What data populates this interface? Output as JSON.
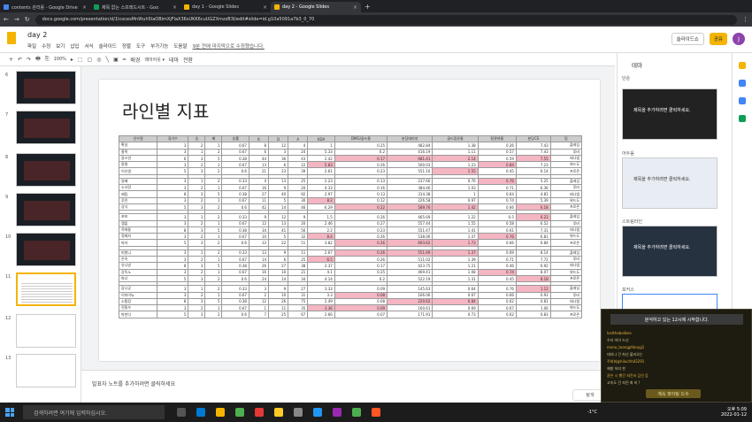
{
  "browser": {
    "tabs": [
      {
        "label": "contents 관리용 - Google Drive",
        "color": "#4285f4"
      },
      {
        "label": "제목 없는 스프레드시트 - Goo",
        "color": "#0f9d58"
      },
      {
        "label": "day 1 - Google Slides",
        "color": "#f4b400"
      },
      {
        "label": "day 2 - Google Slides",
        "color": "#f4b400",
        "active": true
      }
    ],
    "url": "docs.google.com/presentation/d/1lcocesMn9tuh5laOBimXjFlaX36sUKK6cuUGZXmzzB3I/edit#slide=id.g10a5091a7b3_0_70"
  },
  "app": {
    "title": "day 2",
    "menus": [
      "파일",
      "수정",
      "보기",
      "삽입",
      "서식",
      "슬라이드",
      "정렬",
      "도구",
      "부가기능",
      "도움말"
    ],
    "last_edit": "9분 전에 마지막으로 수정했습니다.",
    "slideshow_label": "슬라이드쇼",
    "share_label": "공유",
    "avatar_letter": "J"
  },
  "toolbar": {
    "items": [
      "+",
      "↶",
      "↷",
      "🖶",
      "⎘",
      "100%",
      "▸",
      "⬚",
      "▢",
      "◎",
      "╲",
      "▣",
      "━",
      "배경",
      "레이아웃 ▾",
      "테마",
      "전환"
    ]
  },
  "filmstrip": {
    "slides": [
      {
        "num": "6",
        "style": "dark"
      },
      {
        "num": "7",
        "style": "dark"
      },
      {
        "num": "8",
        "style": "dark"
      },
      {
        "num": "9",
        "style": "dark"
      },
      {
        "num": "10",
        "style": "dark"
      },
      {
        "num": "11",
        "style": "light",
        "selected": true
      },
      {
        "num": "12",
        "style": "light"
      },
      {
        "num": "13",
        "style": "light"
      }
    ]
  },
  "slide": {
    "title": "라인별 지표",
    "columns": [
      "선수명",
      "경기수",
      "승",
      "패",
      "승률",
      "K",
      "D",
      "A",
      "KDA",
      "DMG/골드율",
      "분당데미지",
      "골드점유율",
      "킬관여율",
      "분당CS",
      "팀"
    ],
    "groups": [
      [
        [
          "확실",
          "3",
          "2",
          "1",
          "0.67",
          "8",
          "12",
          "4",
          "1",
          "0.25",
          "482.84",
          "1.38",
          "0.26",
          "7.43",
          "플레임"
        ],
        [
          "홍팍",
          "3",
          "1",
          "2",
          "0.67",
          "6",
          "3",
          "24",
          "5.33",
          "0.2",
          "416.19",
          "1.11",
          "0.57",
          "7.43",
          "루비"
        ],
        [
          "갈스연",
          "6",
          "3",
          "5",
          "0.38",
          "44",
          "36",
          "43",
          "2.42",
          "0.17",
          "681.41",
          "2.14",
          "0.59",
          "7.55",
          "테나엠"
        ],
        [
          "칼띨",
          "3",
          "2",
          "1",
          "0.67",
          "13",
          "6",
          "22",
          "5.83",
          "0.26",
          "500.03",
          "1.23",
          "0.84",
          "7.23",
          "위드도"
        ],
        [
          "이선생",
          "5",
          "3",
          "2",
          "0.6",
          "21",
          "23",
          "39",
          "2.61",
          "0.23",
          "551.16",
          "1.55",
          "0.45",
          "6.14",
          "프로즌"
        ]
      ],
      [
        [
          "쌍베",
          "3",
          "1",
          "2",
          "0.33",
          "4",
          "13",
          "25",
          "2.23",
          "0.13",
          "237.66",
          "0.76",
          "0.76",
          "5.25",
          "플레임"
        ],
        [
          "소사랑",
          "3",
          "2",
          "1",
          "0.67",
          "16",
          "9",
          "20",
          "4.33",
          "0.16",
          "384.46",
          "1.03",
          "0.71",
          "6.36",
          "루비"
        ],
        [
          "제팀",
          "8",
          "3",
          "5",
          "0.38",
          "27",
          "40",
          "92",
          "2.97",
          "0.13",
          "314.38",
          "1",
          "0.64",
          "4.81",
          "테나엠"
        ],
        [
          "루린",
          "3",
          "2",
          "1",
          "0.67",
          "11",
          "5",
          "30",
          "8.2",
          "0.12",
          "226.58",
          "0.97",
          "0.74",
          "5.39",
          "위드도"
        ],
        [
          "상식",
          "5",
          "3",
          "2",
          "0.6",
          "42",
          "14",
          "46",
          "6.29",
          "0.22",
          "589.76",
          "1.42",
          "0.66",
          "6.18",
          "프로즌"
        ]
      ],
      [
        [
          "포포",
          "3",
          "1",
          "2",
          "0.33",
          "9",
          "12",
          "9",
          "1.5",
          "0.26",
          "465.69",
          "1.22",
          "0.5",
          "6.23",
          "플레임"
        ],
        [
          "캠플",
          "3",
          "2",
          "1",
          "0.67",
          "12",
          "13",
          "20",
          "2.46",
          "0.27",
          "557.44",
          "1.55",
          "0.58",
          "6.52",
          "루비"
        ],
        [
          "즉재들",
          "8",
          "3",
          "5",
          "0.38",
          "34",
          "41",
          "56",
          "2.2",
          "0.23",
          "551.47",
          "1.41",
          "0.61",
          "7.31",
          "테나엠"
        ],
        [
          "정제지",
          "3",
          "2",
          "1",
          "0.67",
          "10",
          "5",
          "32",
          "8.4",
          "0.26",
          "538.06",
          "1.47",
          "0.76",
          "6.81",
          "위드도"
        ],
        [
          "따아",
          "5",
          "3",
          "2",
          "0.6",
          "33",
          "22",
          "51",
          "3.82",
          "0.26",
          "693.62",
          "1.73",
          "0.66",
          "6.84",
          "프로즌"
        ]
      ],
      [
        [
          "피봉니",
          "3",
          "1",
          "2",
          "0.33",
          "13",
          "9",
          "11",
          "2.67",
          "0.26",
          "551.69",
          "1.37",
          "0.69",
          "8.14",
          "플레임"
        ],
        [
          "온숙",
          "3",
          "2",
          "1",
          "0.67",
          "14",
          "6",
          "25",
          "6.5",
          "0.26",
          "511.02",
          "1.39",
          "0.71",
          "7.72",
          "루비"
        ],
        [
          "유니방",
          "8",
          "3",
          "5",
          "0.38",
          "26",
          "27",
          "38",
          "2.37",
          "0.17",
          "423.75",
          "1.21",
          "0.46",
          "6.92",
          "테나엠"
        ],
        [
          "강독노",
          "3",
          "2",
          "1",
          "0.67",
          "16",
          "10",
          "21",
          "4.1",
          "0.25",
          "469.41",
          "1.08",
          "0.74",
          "8.07",
          "위드도"
        ],
        [
          "따너",
          "5",
          "3",
          "2",
          "0.6",
          "24",
          "14",
          "34",
          "4.14",
          "0.2",
          "522.19",
          "1.31",
          "0.45",
          "8.18",
          "프로즌"
        ]
      ],
      [
        [
          "감니공",
          "3",
          "1",
          "2",
          "0.33",
          "3",
          "9",
          "27",
          "3.33",
          "0.09",
          "145.63",
          "0.64",
          "0.76",
          "1.12",
          "플레임"
        ],
        [
          "이마이뉴",
          "3",
          "2",
          "1",
          "0.67",
          "2",
          "10",
          "31",
          "3.3",
          "0.08",
          "166.06",
          "0.67",
          "0.66",
          "0.93",
          "루비"
        ],
        [
          "소찜장",
          "8",
          "3",
          "5",
          "0.38",
          "12",
          "26",
          "75",
          "2.49",
          "0.08",
          "220.62",
          "0.84",
          "0.62",
          "0.81",
          "테나엠"
        ],
        [
          "전홍우",
          "3",
          "2",
          "1",
          "0.67",
          "1",
          "11",
          "35",
          "3.36",
          "0.09",
          "160.61",
          "0.69",
          "0.67",
          "1.06",
          "위드도"
        ],
        [
          "박한디",
          "5",
          "3",
          "2",
          "0.6",
          "7",
          "25",
          "67",
          "2.66",
          "0.07",
          "171.91",
          "0.73",
          "0.62",
          "0.83",
          "프로즌"
        ]
      ]
    ],
    "highlights": [
      [
        0,
        2,
        9
      ],
      [
        0,
        2,
        10
      ],
      [
        0,
        2,
        11
      ],
      [
        0,
        2,
        13
      ],
      [
        0,
        3,
        8
      ],
      [
        0,
        3,
        12
      ],
      [
        0,
        4,
        11
      ],
      [
        1,
        0,
        12
      ],
      [
        1,
        3,
        8
      ],
      [
        1,
        4,
        9
      ],
      [
        1,
        4,
        10
      ],
      [
        1,
        4,
        11
      ],
      [
        1,
        4,
        13
      ],
      [
        2,
        0,
        13
      ],
      [
        2,
        3,
        8
      ],
      [
        2,
        3,
        12
      ],
      [
        2,
        4,
        9
      ],
      [
        2,
        4,
        10
      ],
      [
        2,
        4,
        11
      ],
      [
        3,
        0,
        9
      ],
      [
        3,
        0,
        10
      ],
      [
        3,
        0,
        11
      ],
      [
        3,
        1,
        8
      ],
      [
        3,
        3,
        12
      ],
      [
        3,
        4,
        13
      ],
      [
        4,
        0,
        13
      ],
      [
        4,
        1,
        9
      ],
      [
        4,
        2,
        10
      ],
      [
        4,
        2,
        11
      ],
      [
        4,
        3,
        8
      ],
      [
        4,
        3,
        9
      ]
    ]
  },
  "notes_placeholder": "발표자 노트를 추가하려면 클릭하세요",
  "explore_label": "탐색",
  "theme_panel": {
    "title": "테마",
    "themes": [
      {
        "label": "단순",
        "card_text": "제목을 추가하려면 클릭하세요.",
        "bg": "#222",
        "fg": "#fff"
      },
      {
        "label": "어두움",
        "card_text": "제목을 추가하려면 클릭하세요.",
        "bg": "#e8edf3",
        "fg": "#333"
      },
      {
        "label": "스트림라인",
        "card_text": "제목을 추가하려면 클릭하세요.",
        "bg": "#263240",
        "fg": "#fff"
      },
      {
        "label": "포커스",
        "card_text": "",
        "bg": "#fff",
        "fg": "#333"
      }
    ]
  },
  "chat": {
    "banner": "분석하고 있는 12시에 시작합니다.",
    "lines": [
      "lostthebelikes",
      "우리 어이 드신",
      "mono_toongpfaloyg1",
      "대리나 건 최신 불러오는 ",
      "주회회@hiluchhd3291",
      "제발 하지 한",
      "같은 시 빨건 피진터 김인 등",
      "고속도 건 피진 최 미 !"
    ],
    "button": "계속 파이팅 드수",
    "accent": "#f4b400"
  },
  "taskbar": {
    "search_placeholder": "검색하려면 여기에 입력하십시오.",
    "time": "오후 5:09",
    "date": "2022-01-12",
    "weather": "-1°C"
  }
}
